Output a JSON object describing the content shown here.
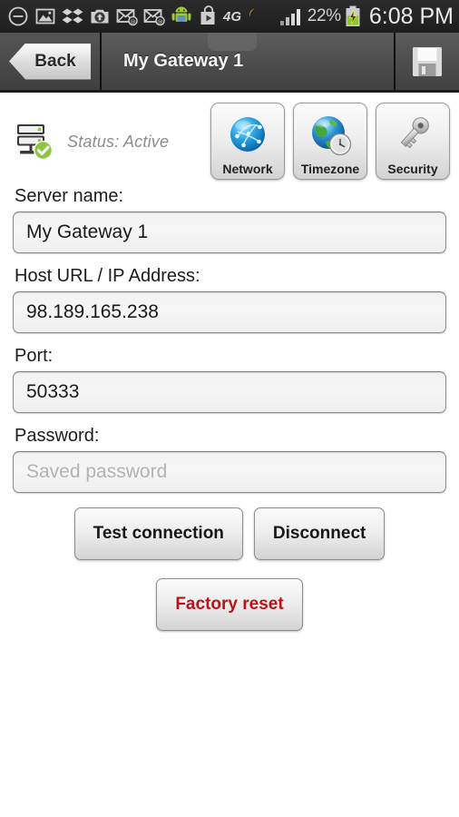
{
  "statusbar": {
    "icons_left": [
      {
        "name": "do-not-disturb-icon",
        "glyph": "minus-circle"
      },
      {
        "name": "gallery-image-icon",
        "glyph": "photo"
      },
      {
        "name": "dropbox-icon",
        "glyph": "dropbox"
      },
      {
        "name": "camera-upload-icon",
        "glyph": "camera-up"
      },
      {
        "name": "email-icon",
        "glyph": "mail-at"
      },
      {
        "name": "email-icon-2",
        "glyph": "mail-at"
      },
      {
        "name": "android-system-update-icon",
        "glyph": "android"
      },
      {
        "name": "play-store-icon",
        "glyph": "play-bag"
      }
    ],
    "network_type": "4G",
    "signal_icon": "signal-bars-icon",
    "battery_percent": "22%",
    "battery_icon": "battery-charging-icon",
    "clock": "6:08 PM"
  },
  "titlebar": {
    "back_label": "Back",
    "title": "My Gateway 1",
    "save_icon": "floppy-save-icon"
  },
  "status": {
    "icon": "server-active-icon",
    "text": "Status: Active"
  },
  "tabs": [
    {
      "label": "Network",
      "icon": "network-globe-icon"
    },
    {
      "label": "Timezone",
      "icon": "world-clock-icon"
    },
    {
      "label": "Security",
      "icon": "key-icon"
    }
  ],
  "form": {
    "server_name": {
      "label": "Server name:",
      "value": "My Gateway 1",
      "placeholder": "Server name"
    },
    "host": {
      "label": "Host URL / IP Address:",
      "value": "98.189.165.238",
      "placeholder": "Host URL / IP Address"
    },
    "port": {
      "label": "Port:",
      "value": "50333",
      "placeholder": "Port"
    },
    "password": {
      "label": "Password:",
      "value": "",
      "placeholder": "Saved password"
    }
  },
  "actions": {
    "test_connection": "Test connection",
    "disconnect": "Disconnect",
    "factory_reset": "Factory reset"
  },
  "colors": {
    "titlebar_bg": "#4f4f4f",
    "statusbar_bg": "#242424",
    "page_bg": "#ffffff",
    "danger": "#c10f18",
    "status_text": "#8d8d8d",
    "accent_blue": "#1f9fe0",
    "accent_green": "#8cc63e"
  }
}
